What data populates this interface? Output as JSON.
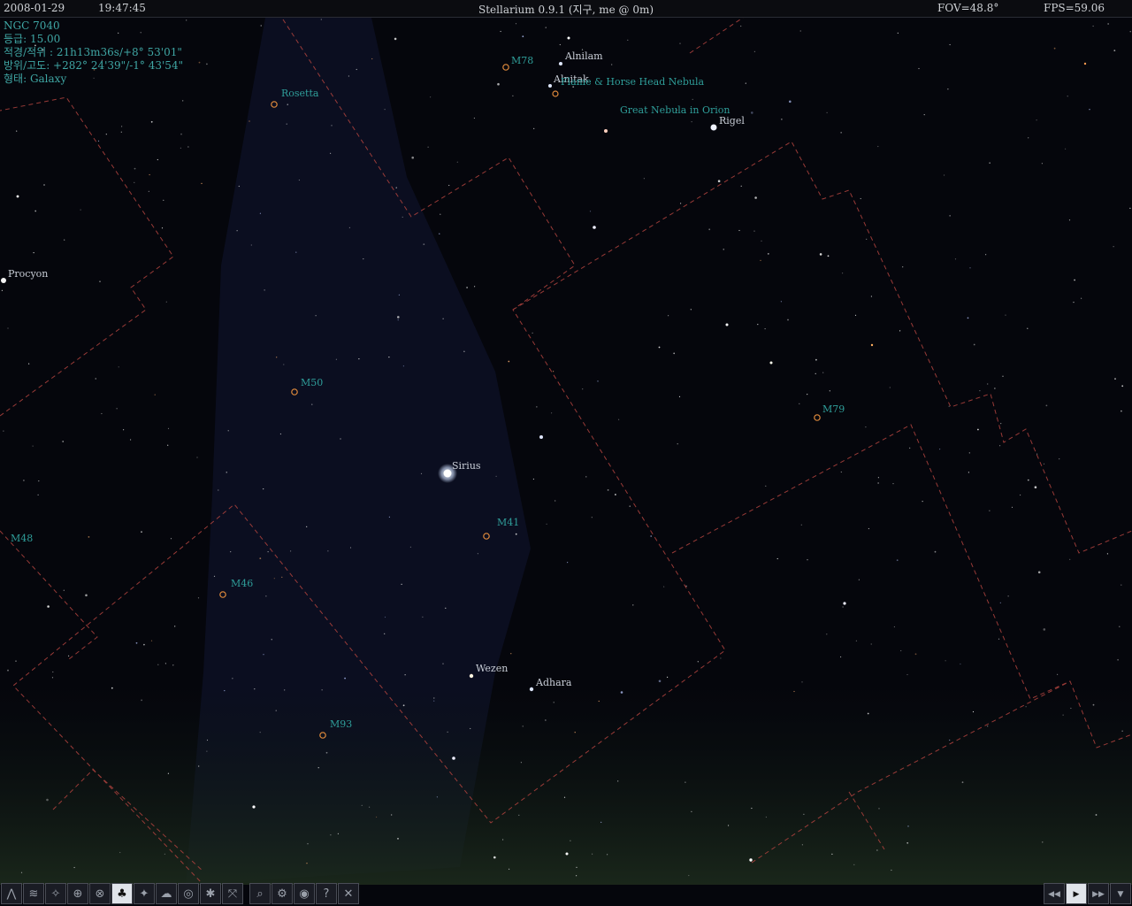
{
  "header": {
    "date": "2008-01-29",
    "time": "19:47:45",
    "title": "Stellarium 0.9.1 (지구, me @ 0m)",
    "fov": "FOV=48.8°",
    "fps": "FPS=59.06"
  },
  "object_info": {
    "name": "NGC 7040",
    "magnitude": "등급: 15.00",
    "ra_dec": "적경/적위 : 21h13m36s/+8° 53'01\"",
    "az_alt": "방위/고도: +282° 24'39\"/-1° 43'54\"",
    "type": "형태: Galaxy"
  },
  "labels": {
    "m78": "M78",
    "alnilam": "Alnilam",
    "alnitak": "Alnitak",
    "flame": "Flame & Horse Head Nebula",
    "orion_neb": "Great Nebula in Orion",
    "rigel": "Rigel",
    "rosetta": "Rosetta",
    "procyon": "Procyon",
    "m50": "M50",
    "m79": "M79",
    "sirius": "Sirius",
    "m41": "M41",
    "m48": "M48",
    "m46": "M46",
    "wezen": "Wezen",
    "adhara": "Adhara",
    "m93": "M93"
  },
  "toolbar": {
    "buttons": [
      {
        "icon": "constellation-lines-icon",
        "glyph": "⋀",
        "active": false
      },
      {
        "icon": "constellation-names-icon",
        "glyph": "≋",
        "active": false
      },
      {
        "icon": "constellation-art-icon",
        "glyph": "✧",
        "active": false
      },
      {
        "icon": "azimuthal-grid-icon",
        "glyph": "⊕",
        "active": false
      },
      {
        "icon": "equatorial-grid-icon",
        "glyph": "⊗",
        "active": false
      },
      {
        "icon": "ground-icon",
        "glyph": "♣",
        "active": true
      },
      {
        "icon": "cardinal-points-icon",
        "glyph": "✦",
        "active": false
      },
      {
        "icon": "atmosphere-icon",
        "glyph": "☁",
        "active": false
      },
      {
        "icon": "nebulae-icon",
        "glyph": "◎",
        "active": false
      },
      {
        "icon": "night-mode-icon",
        "glyph": "✱",
        "active": false
      },
      {
        "icon": "fullscreen-icon",
        "glyph": "⤧",
        "active": false
      },
      {
        "icon": "search-icon",
        "glyph": "⌕",
        "active": false
      },
      {
        "icon": "configuration-icon",
        "glyph": "⚙",
        "active": false
      },
      {
        "icon": "visibility-icon",
        "glyph": "◉",
        "active": false
      },
      {
        "icon": "help-icon",
        "glyph": "?",
        "active": false
      },
      {
        "icon": "quit-icon",
        "glyph": "✕",
        "active": false
      }
    ],
    "time_buttons": [
      {
        "icon": "rewind-icon",
        "glyph": "◀◀"
      },
      {
        "icon": "realtime-icon",
        "glyph": "▶"
      },
      {
        "icon": "fast-forward-icon",
        "glyph": "▶▶"
      },
      {
        "icon": "time-now-icon",
        "glyph": "▼"
      }
    ]
  },
  "colors": {
    "sky": "#05060c",
    "info_text": "#3fa6a4",
    "nebula_label": "#2f9e9a",
    "nebula_marker": "#e08a3c",
    "boundary": "#a8403c"
  }
}
